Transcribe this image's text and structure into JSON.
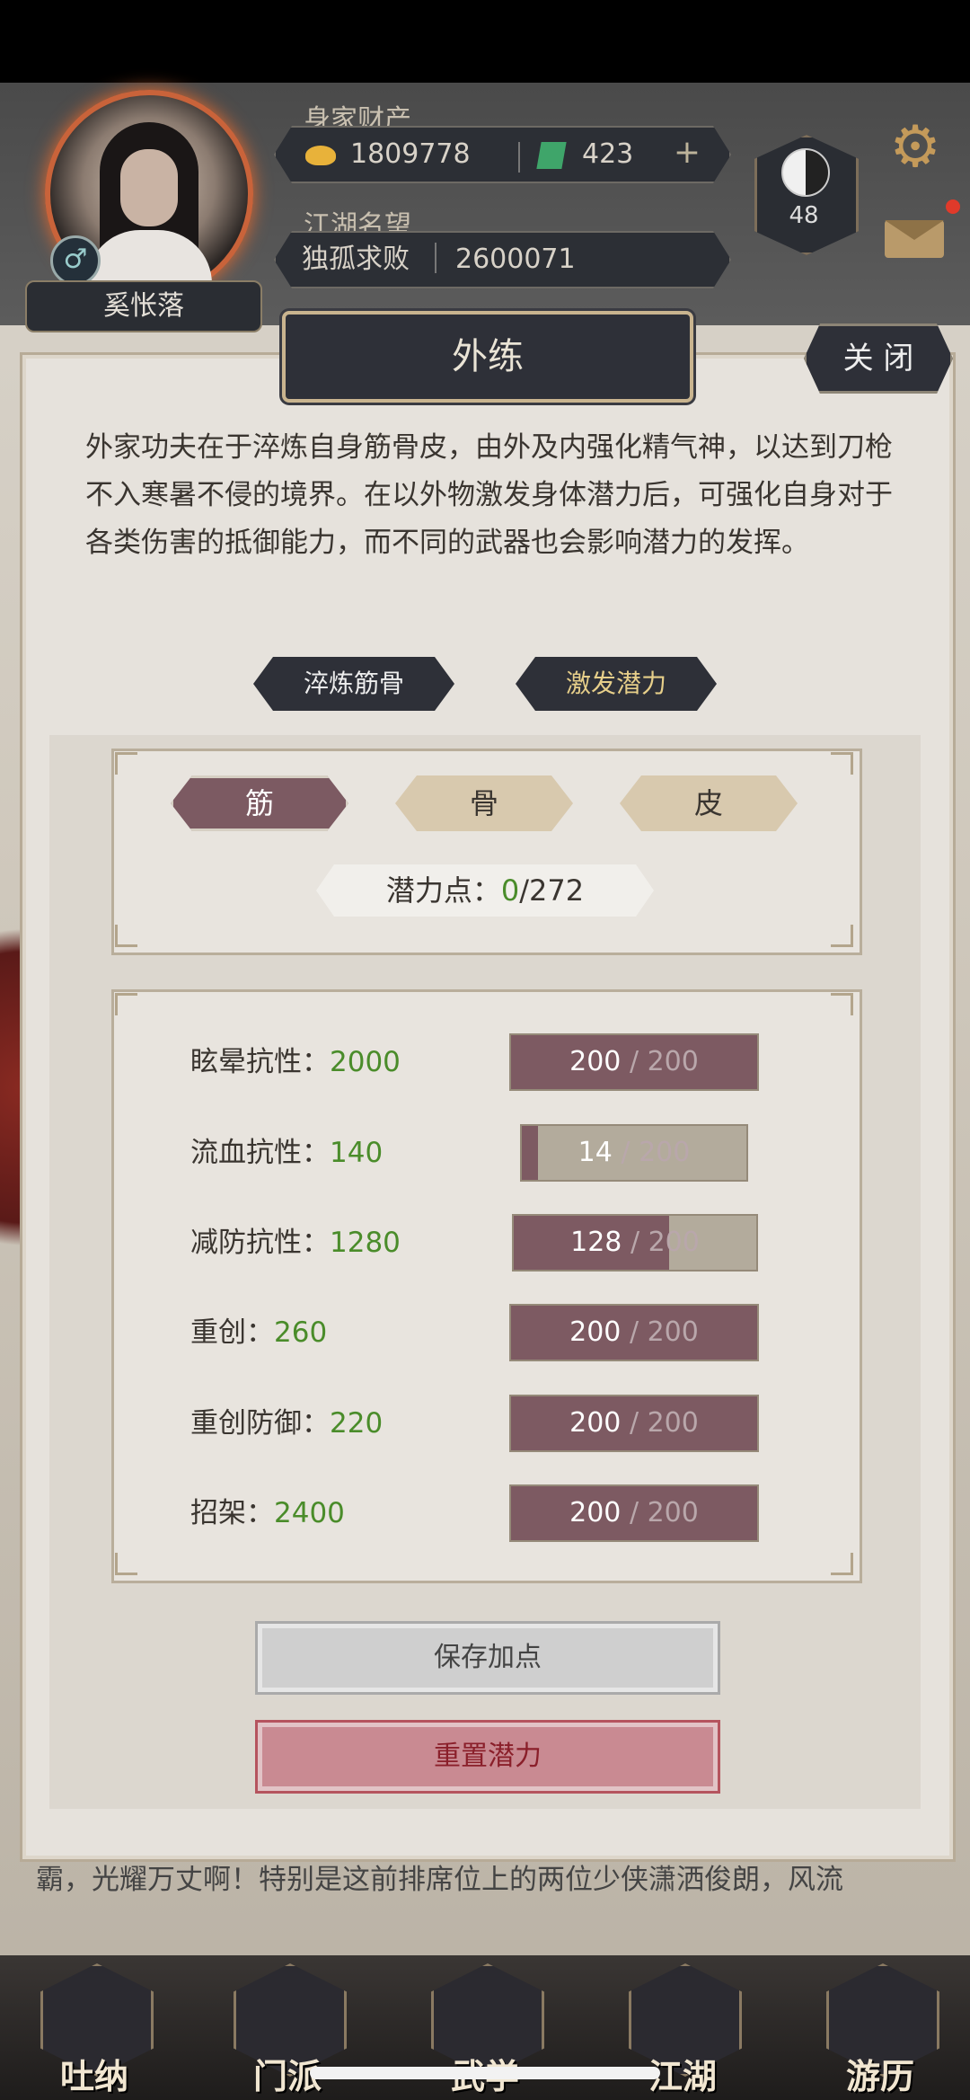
{
  "header": {
    "wealth_label": "身家财产",
    "silver": "1809778",
    "jade": "423",
    "plus": "+",
    "fame_label": "江湖名望",
    "title": "独孤求败",
    "fame": "2600071",
    "level": "48",
    "character_name": "奚怅落",
    "gender_symbol": "♂",
    "gear": "⚙"
  },
  "dialog": {
    "title": "外练",
    "close_label": "关 闭",
    "description": "外家功夫在于淬炼自身筋骨皮，由外及内强化精气神，以达到刀枪不入寒暑不侵的境界。在以外物激发身体潜力后，可强化自身对于各类伤害的抵御能力，而不同的武器也会影响潜力的发挥。",
    "tabs": [
      "淬炼筋骨",
      "激发潜力"
    ],
    "segments": [
      "筋",
      "骨",
      "皮"
    ],
    "potential_label": "潜力点：",
    "potential_current": "0",
    "potential_total": "/272",
    "stats": [
      {
        "label": "眩晕抗性：",
        "value": "2000",
        "current": 200,
        "current_text": "200",
        "max_text": "200",
        "fraction": 1.0
      },
      {
        "label": "流血抗性：",
        "value": "140",
        "current": 14,
        "current_text": "14",
        "max_text": "200",
        "fraction": 0.07
      },
      {
        "label": "减防抗性：",
        "value": "1280",
        "current": 128,
        "current_text": "128",
        "max_text": "200",
        "fraction": 0.64
      },
      {
        "label": "重创：",
        "value": "260",
        "current": 200,
        "current_text": "200",
        "max_text": "200",
        "fraction": 1.0
      },
      {
        "label": "重创防御：",
        "value": "220",
        "current": 200,
        "current_text": "200",
        "max_text": "200",
        "fraction": 1.0
      },
      {
        "label": "招架：",
        "value": "2400",
        "current": 200,
        "current_text": "200",
        "max_text": "200",
        "fraction": 1.0
      }
    ],
    "save_label": "保存加点",
    "reset_label": "重置潜力"
  },
  "news": "霸，光耀万丈啊！特别是这前排席位上的两位少侠潇洒俊朗，风流",
  "nav": [
    "吐纳",
    "门派",
    "武学",
    "江湖",
    "游历"
  ],
  "colors": {
    "accent_green": "#4a8c2a",
    "bar_fill": "#7d5a62",
    "dark_plate": "#2e3038"
  }
}
